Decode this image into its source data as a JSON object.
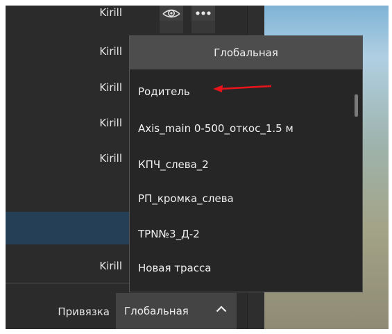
{
  "layer_list": {
    "rows": [
      {
        "author": "Kirill"
      },
      {
        "author": "Kirill"
      },
      {
        "author": "Kirill"
      },
      {
        "author": "Kirill"
      },
      {
        "author": "Kirill"
      },
      {
        "author": ""
      },
      {
        "author": "Kirill"
      }
    ],
    "toolbar_icons": [
      "eye-icon",
      "more-icon"
    ]
  },
  "dropdown": {
    "header": "Глобальная",
    "options": [
      "Родитель",
      "Axis_main 0-500_откос_1.5 м",
      "КПЧ_слева_2",
      "РП_кромка_слева",
      "TPN№3_Д-2",
      "Новая трасса"
    ]
  },
  "binding": {
    "label": "Привязка",
    "value": "Глобальная",
    "chevron_icon": "chevron-up-icon"
  },
  "annotation": {
    "arrow_color": "#e8141c"
  }
}
